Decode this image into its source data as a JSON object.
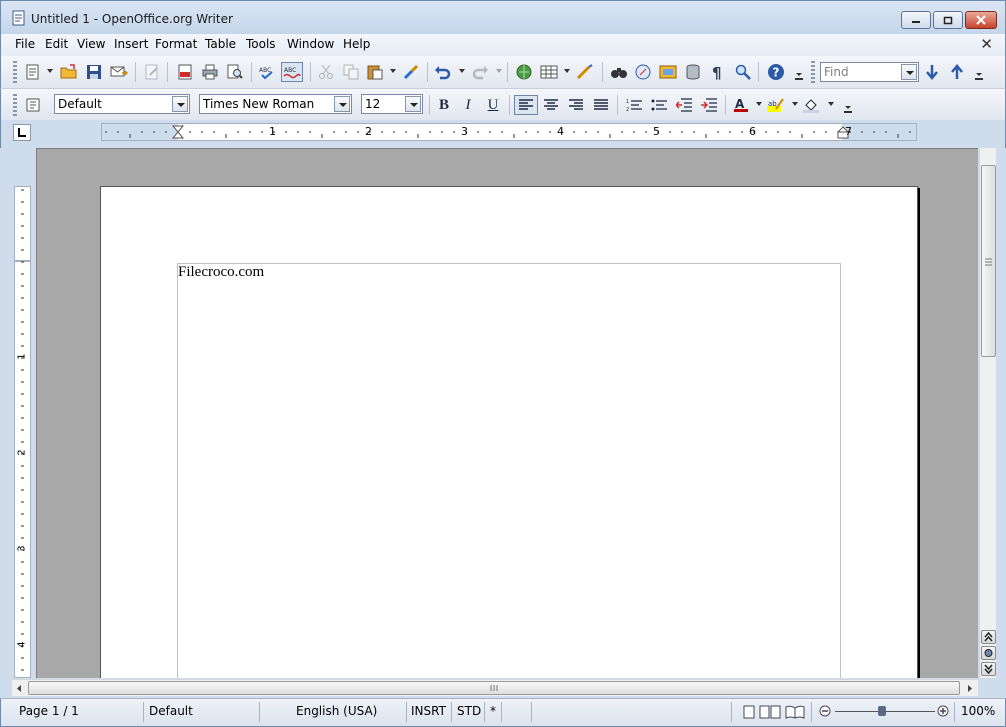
{
  "window": {
    "title": "Untitled 1 - OpenOffice.org Writer",
    "minimize_label": "",
    "maximize_label": "",
    "close_label": ""
  },
  "menubar": {
    "items": [
      "File",
      "Edit",
      "View",
      "Insert",
      "Format",
      "Table",
      "Tools",
      "Window",
      "Help"
    ],
    "doc_close": "✕"
  },
  "standard_toolbar": {
    "icons": [
      "new-document-icon",
      "open-icon",
      "save-icon",
      "email-icon",
      "edit-file-icon",
      "export-pdf-icon",
      "print-icon",
      "page-preview-icon",
      "spellcheck-icon",
      "autospellcheck-icon",
      "cut-icon",
      "copy-icon",
      "paste-icon",
      "clone-formatting-icon",
      "undo-icon",
      "redo-icon",
      "hyperlink-icon",
      "table-icon",
      "show-draw-functions-icon",
      "find-replace-icon",
      "navigator-icon",
      "gallery-icon",
      "data-sources-icon",
      "formatting-marks-icon",
      "zoom-icon",
      "help-icon"
    ],
    "find_placeholder": "Find"
  },
  "formatting_toolbar": {
    "paragraph_style": "Default",
    "font_name": "Times New Roman",
    "font_size": "12",
    "bold": "B",
    "italic": "I",
    "underline": "U",
    "accent_color": "#c00000",
    "highlight_color": "#ffff00"
  },
  "ruler": {
    "h_labels": [
      "1",
      "2",
      "3",
      "4",
      "5",
      "6",
      "7"
    ],
    "v_labels": [
      "1",
      "2",
      "3",
      "4"
    ]
  },
  "document": {
    "text": "Filecroco.com"
  },
  "statusbar": {
    "page": "Page 1 / 1",
    "style": "Default",
    "language": "English (USA)",
    "insert_mode": "INSRT",
    "selection_mode": "STD",
    "modified": "*",
    "zoom": "100%"
  }
}
